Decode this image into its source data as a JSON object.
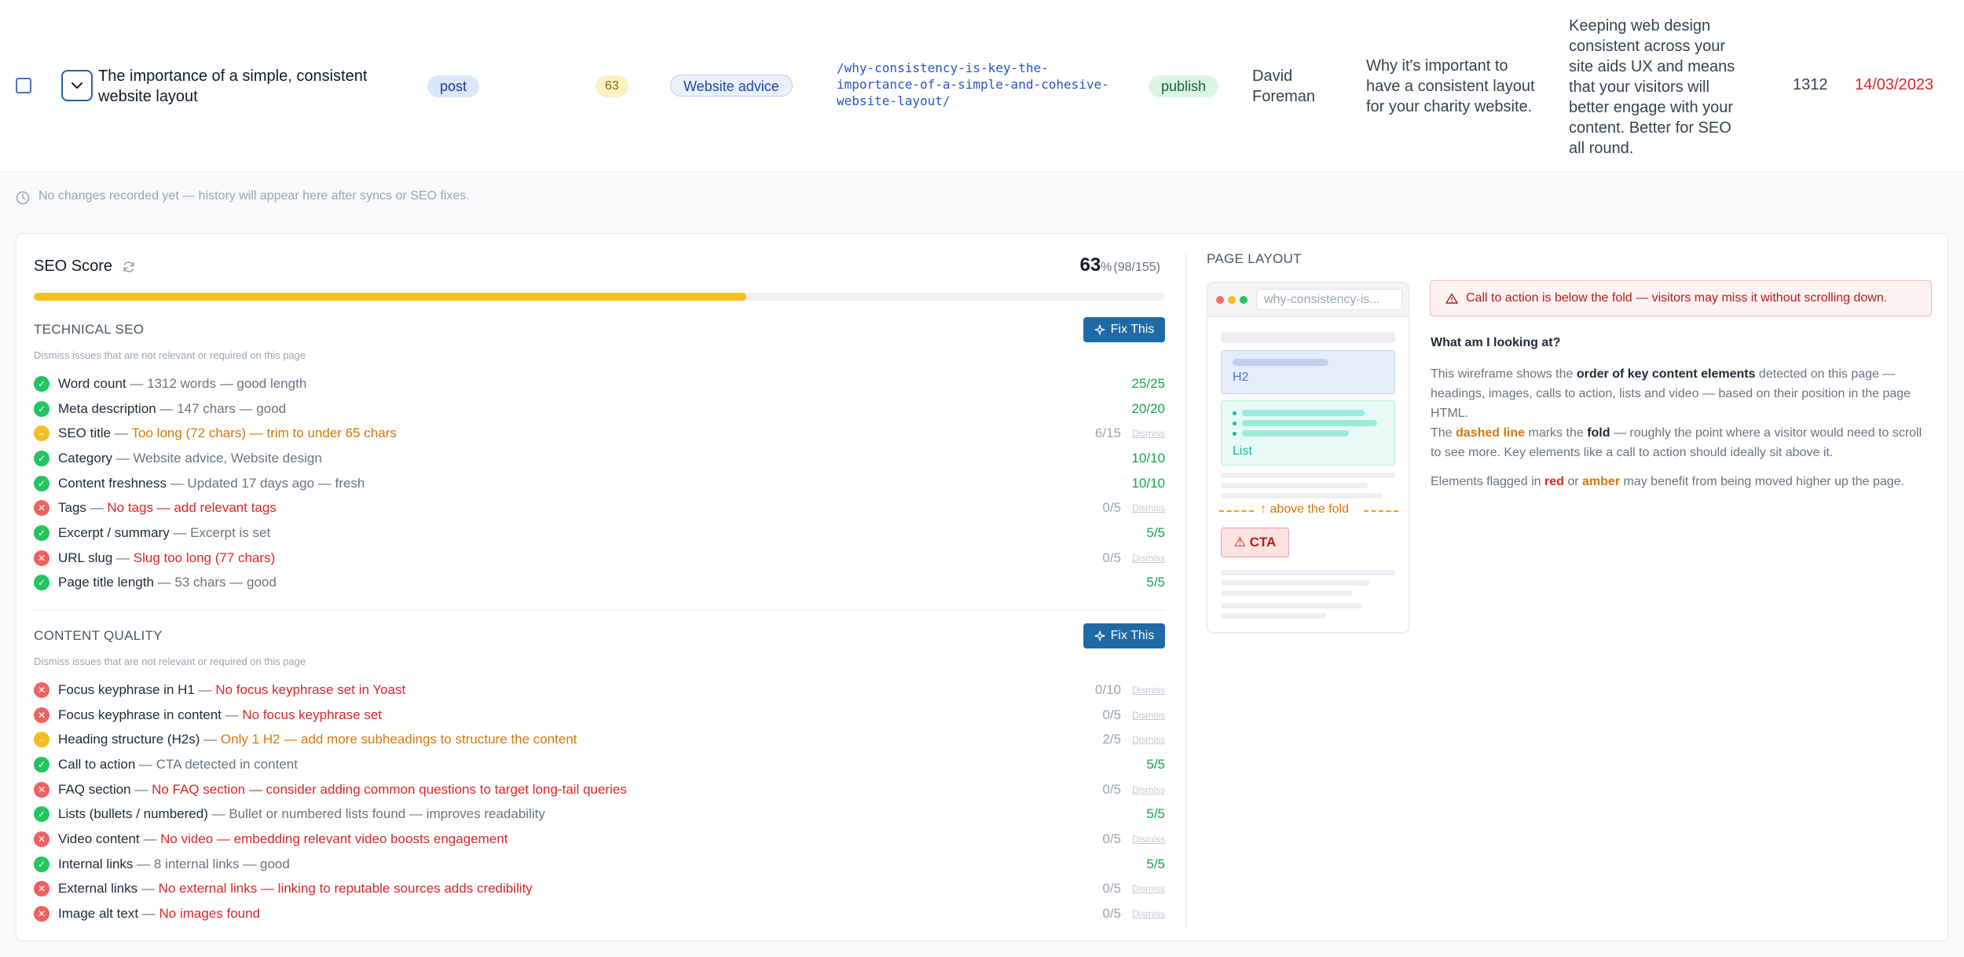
{
  "row": {
    "title": "The importance of a simple, consistent website layout",
    "type": "post",
    "score": "63",
    "category": "Website advice",
    "url": "/why-consistency-is-key-the-importance-of-a-simple-and-cohesive-website-layout/",
    "status": "publish",
    "author": "David Foreman",
    "meta": "Why it's important to have a consistent layout for your charity website.",
    "excerpt": "Keeping web design consistent across your site aids UX and means that your visitors will better engage with your content. Better for SEO all round.",
    "words": "1312",
    "date": "14/03/2023"
  },
  "history": {
    "text": "No changes recorded yet — history will appear here after syncs or SEO fixes."
  },
  "seo": {
    "heading": "SEO Score",
    "percent": "63",
    "percent_suffix": "%",
    "points": "(98/155)",
    "progress": 0.63,
    "fix_label": "Fix This",
    "dismiss_label": "Dismiss",
    "technical": {
      "title": "TECHNICAL SEO",
      "subtitle": "Dismiss issues that are not relevant or required on this page",
      "items": [
        {
          "status": "pass",
          "label": "Word count",
          "detail": "1312 words — good length",
          "score": "25/25"
        },
        {
          "status": "pass",
          "label": "Meta description",
          "detail": "147 chars — good",
          "score": "20/20"
        },
        {
          "status": "warn",
          "label": "SEO title",
          "detail": "Too long (72 chars) — trim to under 65 chars",
          "score": "6/15"
        },
        {
          "status": "pass",
          "label": "Category",
          "detail": "Website advice, Website design",
          "score": "10/10"
        },
        {
          "status": "pass",
          "label": "Content freshness",
          "detail": "Updated 17 days ago — fresh",
          "score": "10/10"
        },
        {
          "status": "fail",
          "label": "Tags",
          "detail": "No tags — add relevant tags",
          "score": "0/5"
        },
        {
          "status": "pass",
          "label": "Excerpt / summary",
          "detail": "Excerpt is set",
          "score": "5/5"
        },
        {
          "status": "fail",
          "label": "URL slug",
          "detail": "Slug too long (77 chars)",
          "score": "0/5"
        },
        {
          "status": "pass",
          "label": "Page title length",
          "detail": "53 chars — good",
          "score": "5/5"
        }
      ]
    },
    "content": {
      "title": "CONTENT QUALITY",
      "subtitle": "Dismiss issues that are not relevant or required on this page",
      "items": [
        {
          "status": "fail",
          "label": "Focus keyphrase in H1",
          "detail": "No focus keyphrase set in Yoast",
          "score": "0/10"
        },
        {
          "status": "fail",
          "label": "Focus keyphrase in content",
          "detail": "No focus keyphrase set",
          "score": "0/5"
        },
        {
          "status": "warn",
          "label": "Heading structure (H2s)",
          "detail": "Only 1 H2 — add more subheadings to structure the content",
          "score": "2/5"
        },
        {
          "status": "pass",
          "label": "Call to action",
          "detail": "CTA detected in content",
          "score": "5/5"
        },
        {
          "status": "fail",
          "label": "FAQ section",
          "detail": "No FAQ section — consider adding common questions to target long-tail queries",
          "score": "0/5"
        },
        {
          "status": "pass",
          "label": "Lists (bullets / numbered)",
          "detail": "Bullet or numbered lists found — improves readability",
          "score": "5/5"
        },
        {
          "status": "fail",
          "label": "Video content",
          "detail": "No video — embedding relevant video boosts engagement",
          "score": "0/5"
        },
        {
          "status": "pass",
          "label": "Internal links",
          "detail": "8 internal links — good",
          "score": "5/5"
        },
        {
          "status": "fail",
          "label": "External links",
          "detail": "No external links — linking to reputable sources adds credibility",
          "score": "0/5"
        },
        {
          "status": "fail",
          "label": "Image alt text",
          "detail": "No images found",
          "score": "0/5"
        }
      ]
    }
  },
  "layout": {
    "title": "PAGE LAYOUT",
    "wire_url": "why-consistency-is...",
    "h2_label": "H2",
    "list_label": "List",
    "fold_label": "↑ above the fold",
    "cta_label": "⚠ CTA",
    "alert": "Call to action is below the fold — visitors may miss it without scrolling down.",
    "question": "What am I looking at?",
    "p1": {
      "a": "This wireframe shows the ",
      "b": "order of key content elements",
      "c": " detected on this page — headings, images, calls to action, lists and video — based on their position in the page HTML."
    },
    "p2": {
      "a": "The ",
      "b": "dashed line",
      "c": " marks the ",
      "d": "fold",
      "e": " — roughly the point where a visitor would need to scroll to see more. Key elements like a call to action should ideally sit above it."
    },
    "p3": {
      "a": "Elements flagged in ",
      "b": "red",
      "c": " or ",
      "d": "amber",
      "e": " may benefit from being moved higher up the page."
    }
  },
  "colors": {
    "accent": "#1f6aa5",
    "progress": "#f6bd25",
    "pass": "#22c55e",
    "fail": "#f06161",
    "warn": "#f6bd25"
  }
}
